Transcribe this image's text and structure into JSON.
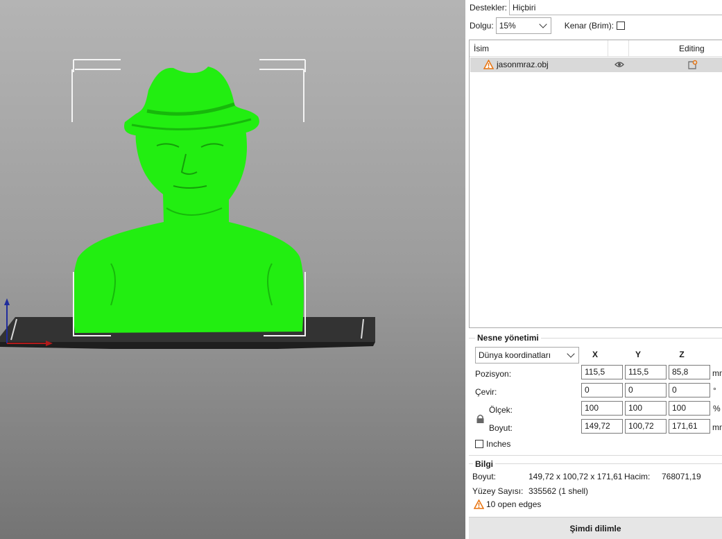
{
  "settings": {
    "supports_label": "Destekler:",
    "supports_value": "Hiçbiri",
    "infill_label": "Dolgu:",
    "infill_value": "15%",
    "brim_label": "Kenar (Brim):"
  },
  "object_list": {
    "col_name": "İsim",
    "col_editing": "Editing",
    "items": [
      {
        "name": "jasonmraz.obj",
        "warning": "warning-icon",
        "visibility": "eye-icon",
        "edit": "edit-icon"
      }
    ]
  },
  "object_manipulation": {
    "title": "Nesne yönetimi",
    "coord_system": "Dünya koordinatları",
    "axes": [
      "X",
      "Y",
      "Z"
    ],
    "position_label": "Pozisyon:",
    "position": [
      "115,5",
      "115,5",
      "85,8"
    ],
    "position_unit": "mm",
    "rotate_label": "Çevir:",
    "rotate": [
      "0",
      "0",
      "0"
    ],
    "rotate_unit": "°",
    "scale_label": "Ölçek:",
    "scale": [
      "100",
      "100",
      "100"
    ],
    "scale_unit": "%",
    "size_label": "Boyut:",
    "size": [
      "149,72",
      "100,72",
      "171,61"
    ],
    "size_unit": "mm",
    "inches_label": "Inches"
  },
  "info": {
    "title": "Bilgi",
    "size_label": "Boyut:",
    "size_value": "149,72 x 100,72 x 171,61",
    "volume_label": "Hacim:",
    "volume_value": "768071,19",
    "facets_label": "Yüzey Sayısı:",
    "facets_value": "335562 (1 shell)",
    "open_edges": "10 open edges"
  },
  "slice_button": "Şimdi dilimle",
  "colors": {
    "model": "#22ee11",
    "bed": "#2e2e2e",
    "accent_warning": "#e8720c"
  }
}
